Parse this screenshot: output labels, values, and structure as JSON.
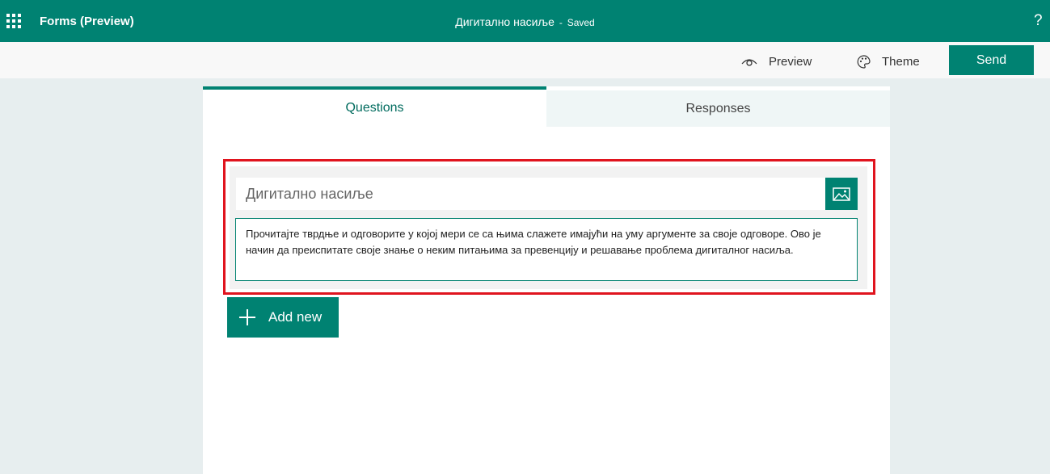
{
  "appbar": {
    "app_title": "Forms (Preview)",
    "doc_title": "Дигитално насиље",
    "separator": "-",
    "save_status": "Saved",
    "help_label": "?"
  },
  "commands": {
    "preview_label": "Preview",
    "theme_label": "Theme",
    "send_label": "Send"
  },
  "tabs": [
    {
      "label": "Questions",
      "active": true
    },
    {
      "label": "Responses",
      "active": false
    }
  ],
  "form": {
    "title": "Дигитално насиље",
    "description": "Прочитајте тврдње и одговорите у којој мери се са њима слажете имајући на уму аргументе за своје одговоре. Ово је начин да преиспитате своје знање о неким питањима за превенцију и решавање проблема дигиталног насиља.",
    "add_new_label": "Add new"
  },
  "colors": {
    "brand": "#008272",
    "highlight": "#e0141e"
  },
  "icons": [
    "app-launcher-icon",
    "help-icon",
    "eye-icon",
    "palette-icon",
    "image-icon",
    "plus-icon"
  ]
}
